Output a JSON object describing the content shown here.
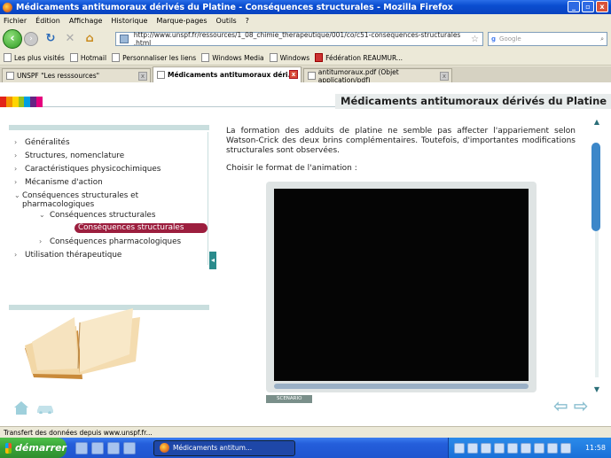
{
  "window": {
    "title": "Médicaments antitumoraux dérivés du Platine - Conséquences structurales - Mozilla Firefox",
    "controls": [
      "_",
      "▫",
      "x"
    ]
  },
  "menu": [
    "Fichier",
    "Édition",
    "Affichage",
    "Historique",
    "Marque-pages",
    "Outils",
    "?"
  ],
  "nav": {
    "url": "http://www.unspf.fr/ressources/1_08_chimie_therapeutique/001/co/c51-consequences-structurales .html",
    "search_engine": "g",
    "search_placeholder": "Google"
  },
  "bookmarks": [
    "Les plus visités",
    "Hotmail",
    "Personnaliser les liens",
    "Windows Media",
    "Windows",
    "Fédération REAUMUR..."
  ],
  "tabs": [
    {
      "label": "UNSPF \"Les resssources\"",
      "active": false
    },
    {
      "label": "Médicaments antitumoraux déri...",
      "active": true
    },
    {
      "label": "antitumoraux.pdf (Objet application/pdf)",
      "active": false
    }
  ],
  "page": {
    "header_title": "Médicaments antitumoraux dérivés du Platine",
    "stripe_colors": [
      "#e2231a",
      "#f39200",
      "#ffd500",
      "#95c11f",
      "#009fe3",
      "#662483",
      "#e5007e"
    ],
    "sidebar": {
      "items": [
        {
          "label": "Généralités",
          "level": 0,
          "arrow": "›"
        },
        {
          "label": "Structures, nomenclature",
          "level": 0,
          "arrow": "›"
        },
        {
          "label": "Caractéristiques physicochimiques",
          "level": 0,
          "arrow": "›"
        },
        {
          "label": "Mécanisme d'action",
          "level": 0,
          "arrow": "›"
        },
        {
          "label": "Conséquences structurales et pharmacologiques",
          "level": 0,
          "arrow": "⌄"
        },
        {
          "label": "Conséquences structurales",
          "level": 1,
          "arrow": "⌄"
        },
        {
          "label": "Conséquences structurales",
          "level": 2,
          "arrow": ""
        },
        {
          "label": "Conséquences pharmacologiques",
          "level": 1,
          "arrow": "›"
        },
        {
          "label": "Utilisation thérapeutique",
          "level": 0,
          "arrow": "›"
        }
      ],
      "collapse_glyph": "◂"
    },
    "paragraph": "La formation des adduits de platine ne semble pas affecter l'appariement selon Watson-Crick des deux brins complémentaires. Toutefois, d'importantes modifications structurales sont observées.",
    "choose": "Choisir le format de l'animation :",
    "scenario_label": "SCENARIO",
    "nav_prev": "⇦",
    "nav_next": "⇨",
    "accent": "#9c1e3e"
  },
  "status": "Transfert des données depuis www.unspf.fr...",
  "taskbar": {
    "start": "démarrer",
    "task": "Médicaments antitum...",
    "clock": "11:58"
  }
}
